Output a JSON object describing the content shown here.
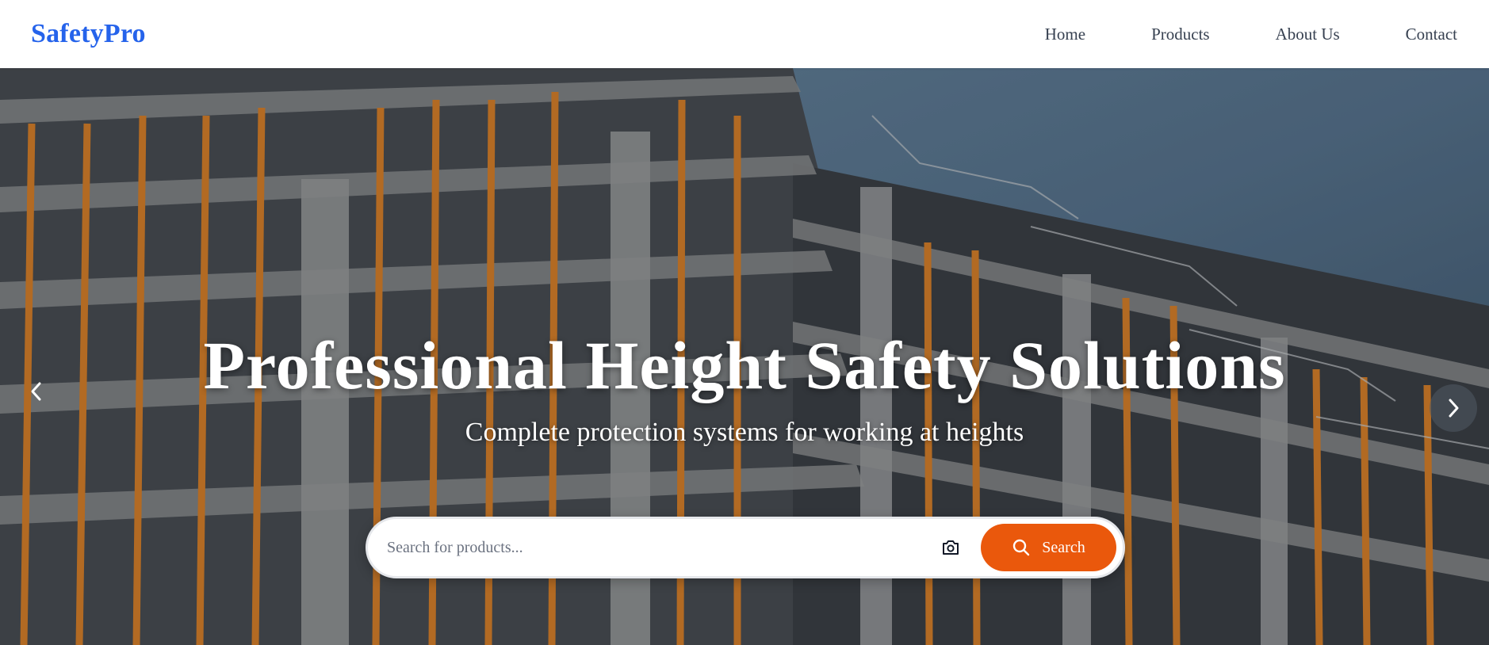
{
  "brand": {
    "logo": "SafetyPro",
    "accent_color": "#2563eb"
  },
  "nav": {
    "items": [
      {
        "label": "Home"
      },
      {
        "label": "Products"
      },
      {
        "label": "About Us"
      },
      {
        "label": "Contact"
      }
    ]
  },
  "hero": {
    "title": "Professional Height Safety Solutions",
    "subtitle": "Complete protection systems for working at heights",
    "background_image": "construction-scaffolding-photo",
    "prev_icon": "chevron-left-icon",
    "next_icon": "chevron-right-icon"
  },
  "search": {
    "placeholder": "Search for products...",
    "value": "",
    "camera_icon": "camera-icon",
    "button_label": "Search",
    "button_icon": "search-icon",
    "button_color": "#ea580c"
  }
}
